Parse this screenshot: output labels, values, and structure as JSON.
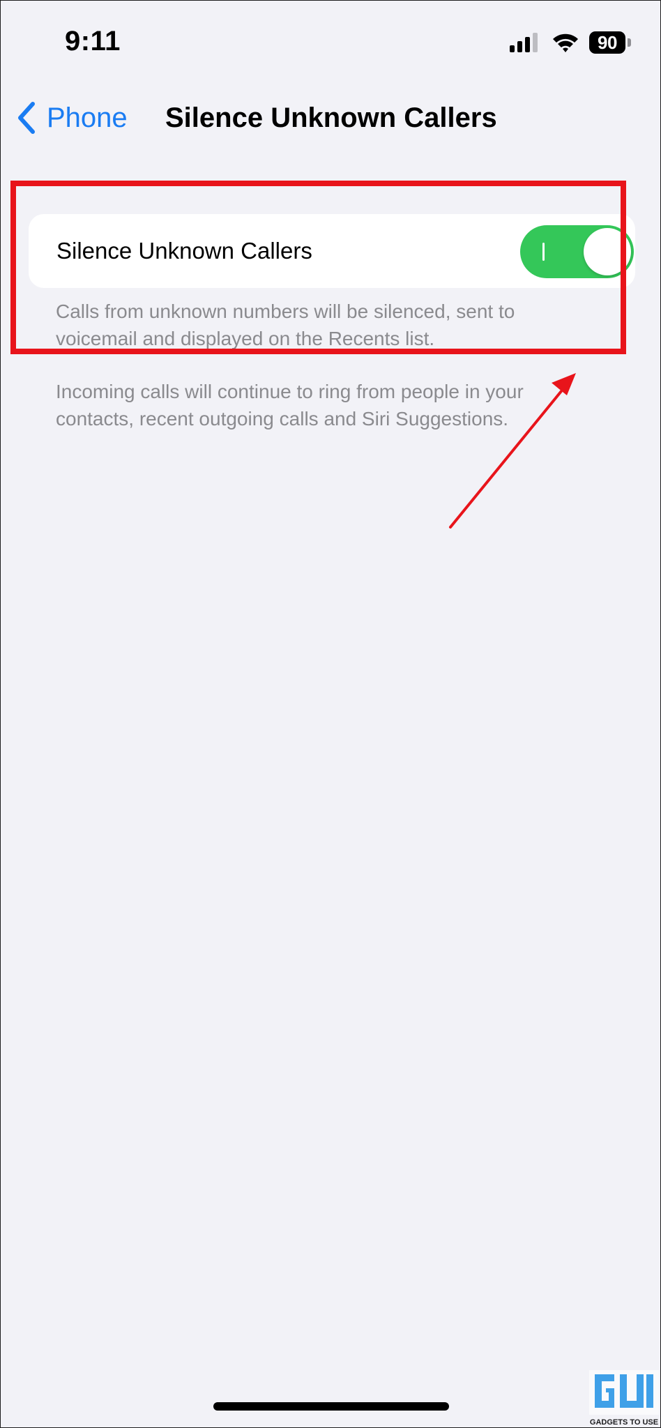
{
  "status_bar": {
    "time": "9:11",
    "battery_level": "90",
    "icons": [
      "cellular-signal-icon",
      "wifi-icon",
      "battery-icon"
    ]
  },
  "nav": {
    "back_label": "Phone",
    "back_icon": "chevron-left-icon",
    "title": "Silence Unknown Callers"
  },
  "setting": {
    "label": "Silence Unknown Callers",
    "toggle_on": true,
    "toggle_color": "#34c759"
  },
  "footers": {
    "description": "Calls from unknown numbers will be silenced, sent to voicemail and displayed on the Recents list.",
    "note": "Incoming calls will continue to ring from people in your contacts, recent outgoing calls and Siri Suggestions."
  },
  "colors": {
    "accent": "#1a7cf2",
    "annotation": "#e8141b",
    "background": "#f2f2f7"
  },
  "watermark": {
    "text": "GADGETS TO USE"
  }
}
